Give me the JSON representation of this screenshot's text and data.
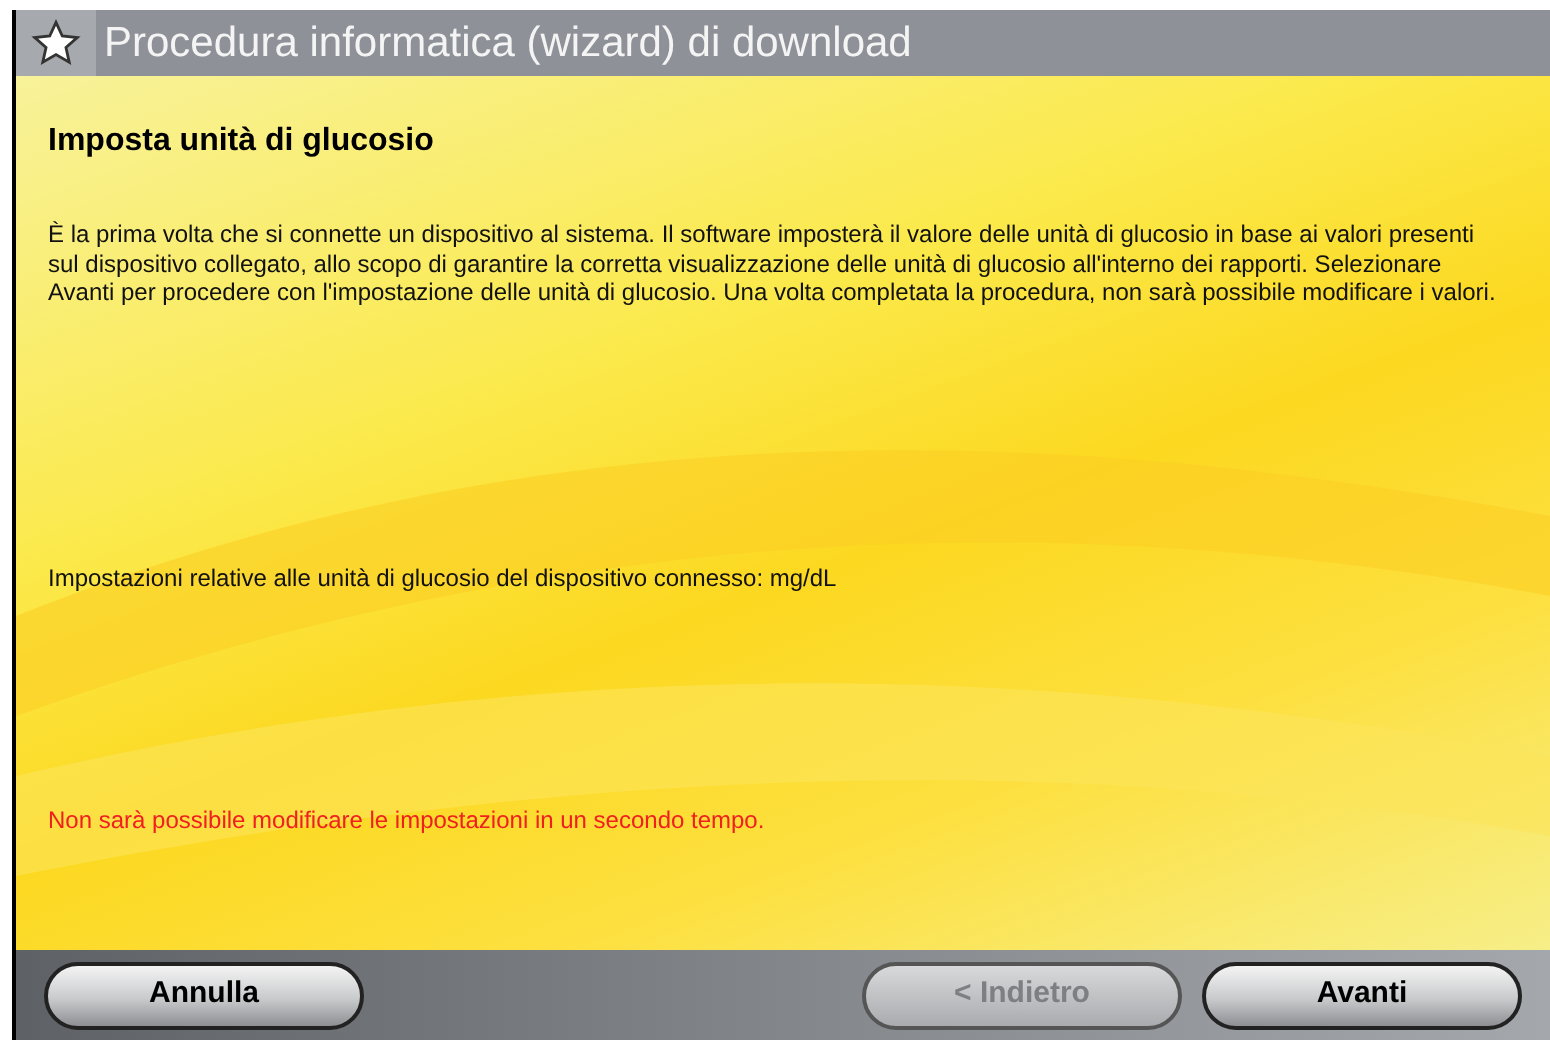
{
  "window": {
    "title": "Procedura informatica (wizard) di download"
  },
  "page": {
    "heading": "Imposta unità di glucosio",
    "description": "È la prima volta che si connette un dispositivo al sistema.  Il software imposterà il valore delle unità di glucosio in base ai valori presenti sul dispositivo collegato, allo scopo di garantire la corretta visualizzazione delle unità di glucosio all'interno dei rapporti.  Selezionare Avanti per procedere con l'impostazione delle unità di glucosio.  Una volta completata la procedura, non sarà possibile modificare i valori.",
    "device_setting": "Impostazioni relative alle unità di glucosio del dispositivo connesso:  mg/dL",
    "warning": "Non sarà possibile modificare le impostazioni in un secondo tempo."
  },
  "buttons": [
    {
      "label": "Annulla",
      "disabled": false
    },
    {
      "label": "< Indietro",
      "disabled": true
    },
    {
      "label": "Avanti",
      "disabled": false
    }
  ]
}
